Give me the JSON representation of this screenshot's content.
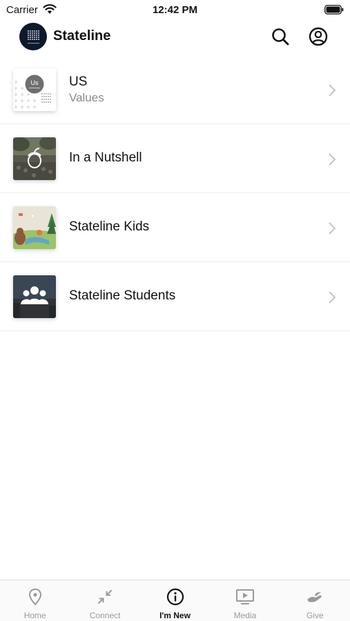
{
  "status_bar": {
    "carrier": "Carrier",
    "time": "12:42 PM"
  },
  "header": {
    "title": "Stateline",
    "logo_icon": "stateline-logo",
    "search_icon": "search-icon",
    "profile_icon": "user-circle-icon"
  },
  "list": {
    "items": [
      {
        "title": "US",
        "subtitle": "Values",
        "thumb_text": "Us"
      },
      {
        "title": "In a Nutshell",
        "subtitle": ""
      },
      {
        "title": "Stateline Kids",
        "subtitle": ""
      },
      {
        "title": "Stateline Students",
        "subtitle": ""
      }
    ]
  },
  "tabs": [
    {
      "label": "Home",
      "icon": "location-pin-icon",
      "active": false
    },
    {
      "label": "Connect",
      "icon": "collapse-arrows-icon",
      "active": false
    },
    {
      "label": "I'm New",
      "icon": "info-circle-icon",
      "active": true
    },
    {
      "label": "Media",
      "icon": "tv-play-icon",
      "active": false
    },
    {
      "label": "Give",
      "icon": "hand-give-icon",
      "active": false
    }
  ],
  "colors": {
    "active_tab": "#111111",
    "inactive_tab": "#9a9a9a",
    "subtitle": "#8a8a8a",
    "divider": "#ececec"
  }
}
